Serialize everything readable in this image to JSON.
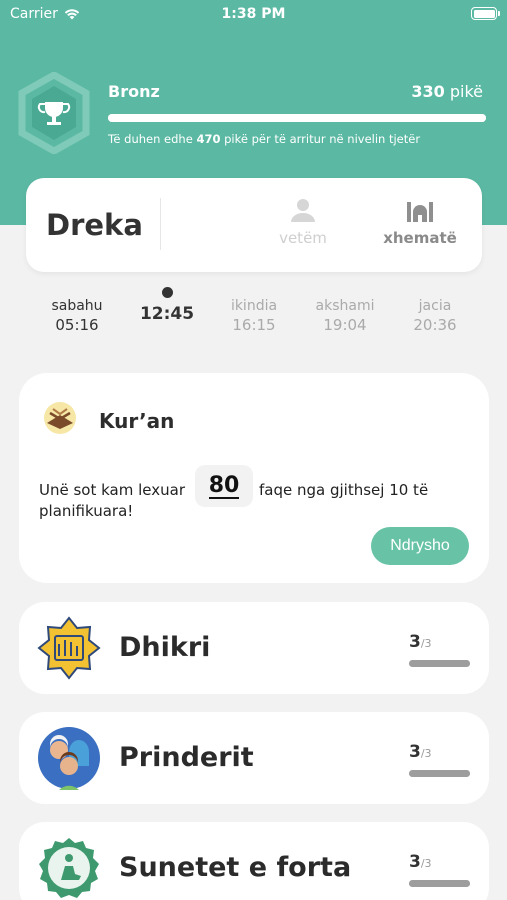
{
  "status_bar": {
    "carrier": "Carrier",
    "time": "1:38 PM"
  },
  "level": {
    "name": "Bronz",
    "points": "330",
    "points_unit": "pikë",
    "progress": 1.0,
    "note_prefix": "Të duhen edhe",
    "note_points": "470",
    "note_suffix": "pikë për të arritur në nivelin tjetër"
  },
  "prayer": {
    "current_name": "Dreka",
    "mode_alone": "vetëm",
    "mode_congregation": "xhematë"
  },
  "prayer_times": [
    {
      "name": "sabahu",
      "time": "05:16",
      "state": "past"
    },
    {
      "name": "",
      "time": "12:45",
      "state": "current"
    },
    {
      "name": "ikindia",
      "time": "16:15",
      "state": "upcoming"
    },
    {
      "name": "akshami",
      "time": "19:04",
      "state": "upcoming"
    },
    {
      "name": "jacia",
      "time": "20:36",
      "state": "upcoming"
    }
  ],
  "quran": {
    "title": "Kur’an",
    "text_before": "Unë sot kam lexuar",
    "pages": "80",
    "text_after": "faqe nga gjithsej 10 të",
    "text_line2": "planifikuara!",
    "button": "Ndrysho"
  },
  "activities": [
    {
      "title": "Dhikri",
      "score": "3",
      "total": "/3",
      "progress": 1.0,
      "icon": "dhikr-icon"
    },
    {
      "title": "Prinderit",
      "score": "3",
      "total": "/3",
      "progress": 1.0,
      "icon": "parents-icon"
    },
    {
      "title": "Sunetet e forta",
      "score": "3",
      "total": "/3",
      "progress": 1.0,
      "icon": "sunnah-icon"
    }
  ],
  "colors": {
    "accent": "#5bb9a3",
    "button": "#68c3a6",
    "background": "#f2f2f2"
  }
}
